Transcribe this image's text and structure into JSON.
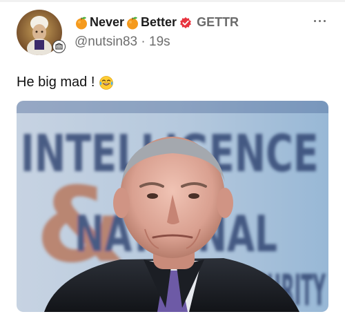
{
  "post": {
    "author": {
      "name_part1": "Never",
      "name_part2": "Better",
      "platform": "GETTR",
      "handle": "@nutsin83",
      "separator": "·",
      "time": "19s",
      "name_emoji": "orange-emoji",
      "verified_icon": "verified-badge-icon"
    },
    "text": "He big mad !",
    "text_emoji": "tears-of-joy-emoji",
    "image": {
      "caption_words": [
        "INTELLIGENCE",
        "&",
        "NATIONAL",
        "SECURITY"
      ]
    }
  },
  "colors": {
    "verified": "#e8343f",
    "handle": "#6d6d6d",
    "platform": "#6b6b6b",
    "orange_emoji": "#f59a1d"
  }
}
